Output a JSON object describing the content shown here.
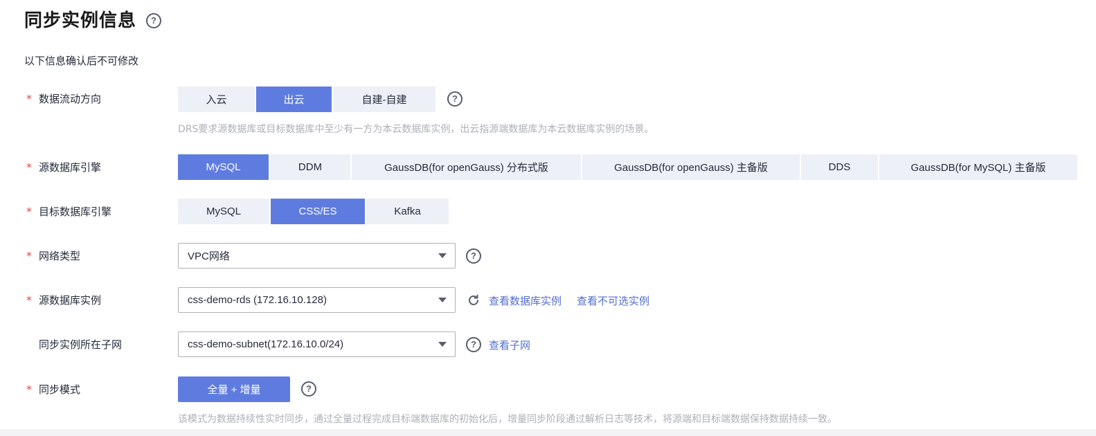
{
  "header": {
    "title": "同步实例信息",
    "subtitle": "以下信息确认后不可修改"
  },
  "direction": {
    "label": "数据流动方向",
    "options": [
      "入云",
      "出云",
      "自建-自建"
    ],
    "selected": "出云",
    "hint": "DRS要求源数据库或目标数据库中至少有一方为本云数据库实例，出云指源端数据库为本云数据库实例的场景。"
  },
  "source_engine": {
    "label": "源数据库引擎",
    "options": [
      "MySQL",
      "DDM",
      "GaussDB(for openGauss) 分布式版",
      "GaussDB(for openGauss) 主备版",
      "DDS",
      "GaussDB(for MySQL) 主备版"
    ],
    "selected": "MySQL"
  },
  "target_engine": {
    "label": "目标数据库引擎",
    "options": [
      "MySQL",
      "CSS/ES",
      "Kafka"
    ],
    "selected": "CSS/ES"
  },
  "network": {
    "label": "网络类型",
    "value": "VPC网络"
  },
  "source_instance": {
    "label": "源数据库实例",
    "value": "css-demo-rds (172.16.10.128)",
    "link_view": "查看数据库实例",
    "link_unavailable": "查看不可选实例"
  },
  "subnet": {
    "label": "同步实例所在子网",
    "value": "css-demo-subnet(172.16.10.0/24)",
    "link_view": "查看子网"
  },
  "sync_mode": {
    "label": "同步模式",
    "button": "全量 + 增量",
    "hint": "该模式为数据持续性实时同步，通过全量过程完成目标端数据库的初始化后，增量同步阶段通过解析日志等技术，将源端和目标端数据保持数据持续一致。"
  },
  "required_mark": "*",
  "help_glyph": "?",
  "colors": {
    "accent": "#5e7ce0",
    "segment_bg": "#eef0f8",
    "link": "#526ecc",
    "required": "#e54545",
    "hint": "#adb0b8"
  }
}
